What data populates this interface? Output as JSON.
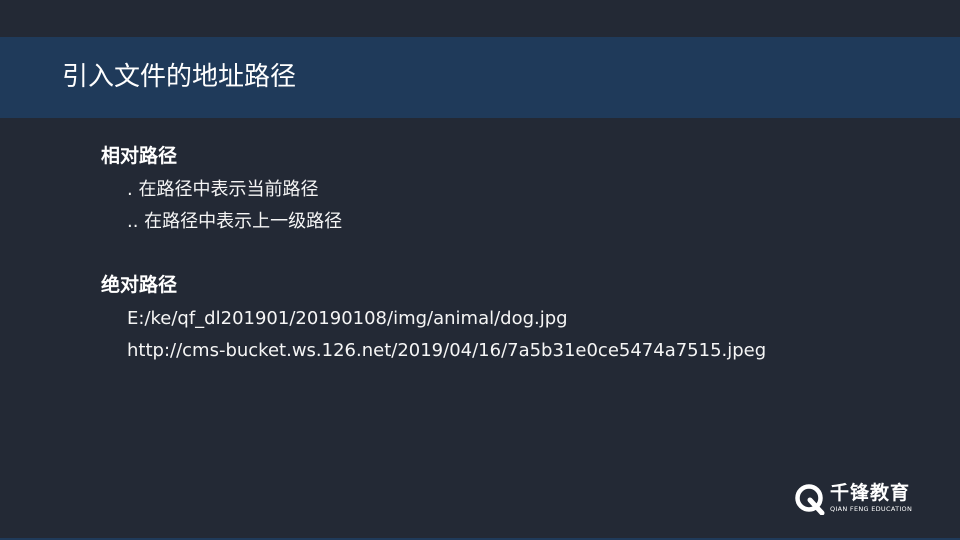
{
  "slide": {
    "title": "引入文件的地址路径",
    "sections": [
      {
        "heading": "相对路径",
        "items": [
          ". 在路径中表示当前路径",
          ".. 在路径中表示上一级路径"
        ]
      },
      {
        "heading": "绝对路径",
        "items": [
          "E:/ke/qf_dl201901/20190108/img/animal/dog.jpg",
          "http://cms-bucket.ws.126.net/2019/04/16/7a5b31e0ce5474a7515.jpeg"
        ]
      }
    ]
  },
  "logo": {
    "name": "千锋教育",
    "subtitle": "QIAN FENG EDUCATION",
    "icon": "qianfeng-q-logo-icon"
  },
  "colors": {
    "background": "#232935",
    "title_band": "#1f3a5a",
    "text": "#ffffff"
  }
}
